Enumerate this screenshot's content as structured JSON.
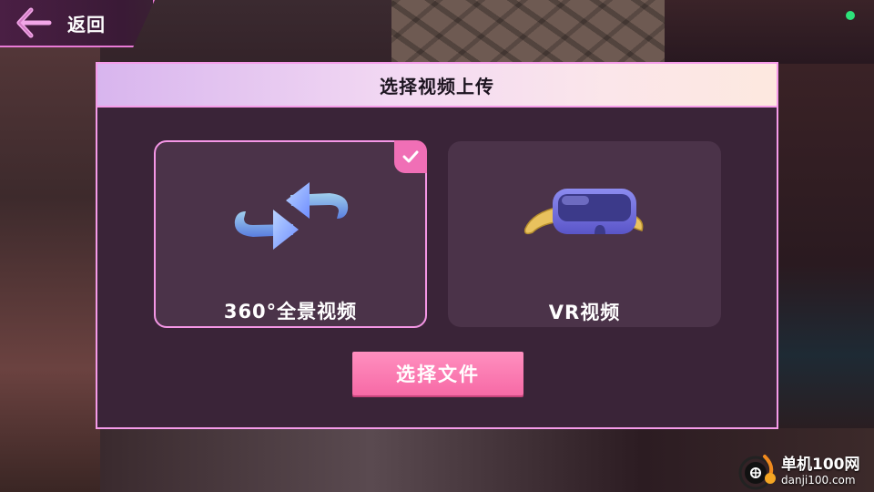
{
  "topbar": {
    "back_label": "返回"
  },
  "dialog": {
    "title": "选择视频上传",
    "options": [
      {
        "label": "360°全景视频",
        "icon": "rotate-360-icon",
        "selected": true
      },
      {
        "label": "VR视频",
        "icon": "vr-headset-icon",
        "selected": false
      }
    ],
    "select_button_label": "选择文件"
  },
  "watermark": {
    "line1": "单机100网",
    "line2": "danji100.com"
  },
  "colors": {
    "accent_pink": "#f76aa6",
    "border_pink": "#f59be9",
    "dialog_bg": "#3a2438",
    "card_bg": "#4b3349",
    "status_green": "#2de27a"
  }
}
